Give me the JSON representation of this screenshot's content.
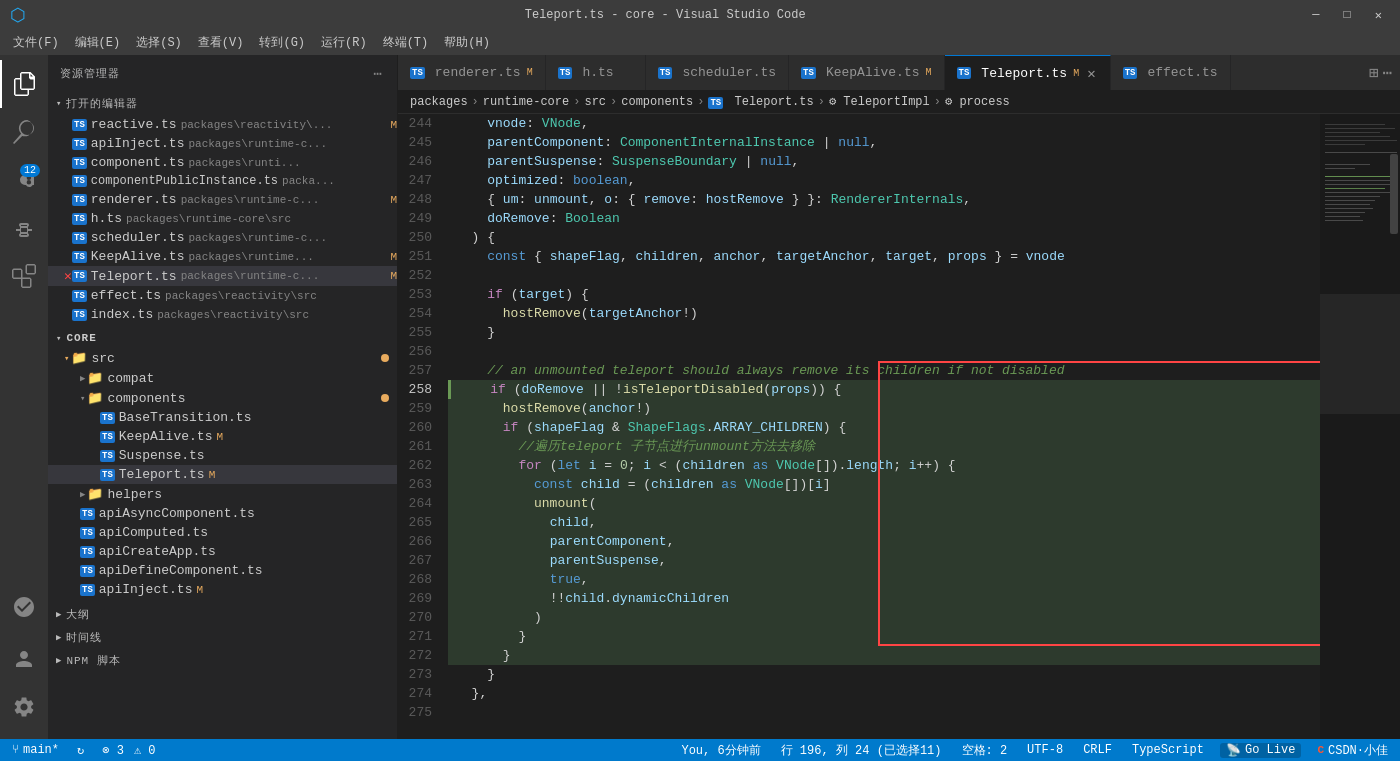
{
  "titleBar": {
    "title": "Teleport.ts - core - Visual Studio Code",
    "windowControls": [
      "minimize",
      "maximize",
      "close"
    ]
  },
  "menuBar": {
    "items": [
      "文件(F)",
      "编辑(E)",
      "选择(S)",
      "查看(V)",
      "转到(G)",
      "运行(R)",
      "终端(T)",
      "帮助(H)"
    ]
  },
  "activityBar": {
    "icons": [
      {
        "name": "explorer-icon",
        "symbol": "⎘",
        "active": true
      },
      {
        "name": "search-icon",
        "symbol": "🔍",
        "active": false
      },
      {
        "name": "source-control-icon",
        "symbol": "⑂",
        "active": false,
        "badge": "12"
      },
      {
        "name": "run-debug-icon",
        "symbol": "▷",
        "active": false
      },
      {
        "name": "extensions-icon",
        "symbol": "⊞",
        "active": false
      },
      {
        "name": "remote-icon",
        "symbol": "⊙",
        "active": false
      }
    ],
    "bottomIcons": [
      {
        "name": "account-icon",
        "symbol": "👤"
      },
      {
        "name": "settings-icon",
        "symbol": "⚙"
      }
    ]
  },
  "sidebar": {
    "title": "资源管理器",
    "openEditors": {
      "label": "打开的编辑器",
      "files": [
        {
          "name": "reactive.ts",
          "path": "packages\\reactivity\\...",
          "modified": true,
          "ts": true
        },
        {
          "name": "apiInject.ts",
          "path": "packages\\runtime-c...",
          "modified": false,
          "ts": true
        },
        {
          "name": "component.ts",
          "path": "packages\\runti...",
          "modified": false,
          "ts": true
        },
        {
          "name": "componentPublicInstance.ts",
          "path": "packa...",
          "modified": false,
          "ts": true
        },
        {
          "name": "renderer.ts",
          "path": "packages\\runtime-c...",
          "modified": true,
          "ts": true
        },
        {
          "name": "h.ts",
          "path": "packages\\runtime-core\\src",
          "modified": false,
          "ts": true
        },
        {
          "name": "scheduler.ts",
          "path": "packages\\runtime-c...",
          "modified": false,
          "ts": true
        },
        {
          "name": "KeepAlive.ts",
          "path": "packages\\runtime...",
          "modified": true,
          "ts": true
        },
        {
          "name": "Teleport.ts",
          "path": "packages\\runtime-c...",
          "modified": true,
          "active": true,
          "ts": true
        },
        {
          "name": "effect.ts",
          "path": "packages\\reactivity\\src",
          "modified": false,
          "ts": true
        },
        {
          "name": "index.ts",
          "path": "packages\\reactivity\\src",
          "modified": false,
          "ts": true
        }
      ]
    },
    "core": {
      "label": "CORE",
      "src": {
        "label": "src",
        "hasChanges": true,
        "children": [
          {
            "label": "compat",
            "type": "folder",
            "collapsed": true
          },
          {
            "label": "components",
            "type": "folder",
            "collapsed": false,
            "hasChanges": true,
            "children": [
              {
                "label": "BaseTransition.ts",
                "ts": true
              },
              {
                "label": "KeepAlive.ts",
                "ts": true,
                "modified": true
              },
              {
                "label": "Suspense.ts",
                "ts": true
              },
              {
                "label": "Teleport.ts",
                "ts": true,
                "active": true,
                "modified": true
              }
            ]
          },
          {
            "label": "helpers",
            "type": "folder",
            "collapsed": true
          },
          {
            "label": "apiAsyncComponent.ts",
            "ts": true
          },
          {
            "label": "apiComputed.ts",
            "ts": true
          },
          {
            "label": "apiCreateApp.ts",
            "ts": true
          },
          {
            "label": "apiDefineComponent.ts",
            "ts": true
          },
          {
            "label": "apiInject.ts",
            "ts": true,
            "modified": true
          }
        ]
      }
    },
    "otherSections": [
      {
        "label": "大纲"
      },
      {
        "label": "时间线"
      },
      {
        "label": "NPM 脚本"
      }
    ]
  },
  "tabs": [
    {
      "id": "renderer",
      "label": "renderer.ts",
      "modified": true,
      "active": false
    },
    {
      "id": "h",
      "label": "h.ts",
      "modified": false,
      "active": false
    },
    {
      "id": "scheduler",
      "label": "scheduler.ts",
      "modified": false,
      "active": false
    },
    {
      "id": "KeepAlive",
      "label": "KeepAlive.ts",
      "modified": true,
      "active": false
    },
    {
      "id": "Teleport",
      "label": "Teleport.ts",
      "modified": true,
      "active": true
    },
    {
      "id": "effect",
      "label": "effect.ts",
      "modified": false,
      "active": false
    }
  ],
  "breadcrumb": {
    "items": [
      "packages",
      "runtime-core",
      "src",
      "components",
      "Teleport.ts",
      "TeleportImpl",
      "process"
    ]
  },
  "codeLines": [
    {
      "num": 244,
      "text": "    vnode: VNode,"
    },
    {
      "num": 245,
      "text": "    parentComponent: ComponentInternalInstance | null,"
    },
    {
      "num": 246,
      "text": "    parentSuspense: SuspenseBoundary | null,"
    },
    {
      "num": 247,
      "text": "    optimized: boolean,"
    },
    {
      "num": 248,
      "text": "    { um: unmount, o: { remove: hostRemove } }: RendererInternals,"
    },
    {
      "num": 249,
      "text": "    doRemove: Boolean"
    },
    {
      "num": 250,
      "text": "  ) {"
    },
    {
      "num": 251,
      "text": "    const { shapeFlag, children, anchor, targetAnchor, target, props } = vnode"
    },
    {
      "num": 252,
      "text": ""
    },
    {
      "num": 253,
      "text": "    if (target) {"
    },
    {
      "num": 254,
      "text": "      hostRemove(targetAnchor!)"
    },
    {
      "num": 255,
      "text": "    }"
    },
    {
      "num": 256,
      "text": ""
    },
    {
      "num": 257,
      "text": "    // an unmounted teleport should always remove its children if not disabled"
    },
    {
      "num": 258,
      "text": "    if (doRemove || !isTeleportDisabled(props)) {",
      "highlighted": true
    },
    {
      "num": 259,
      "text": "      hostRemove(anchor!)",
      "highlighted": true
    },
    {
      "num": 260,
      "text": "      if (shapeFlag & ShapeFlags.ARRAY_CHILDREN) {",
      "highlighted": true
    },
    {
      "num": 261,
      "text": "        //遍历teleport 子节点进行unmount方法去移除",
      "highlighted": true
    },
    {
      "num": 262,
      "text": "        for (let i = 0; i < (children as VNode[]).length; i++) {",
      "highlighted": true
    },
    {
      "num": 263,
      "text": "          const child = (children as VNode[])[i]",
      "highlighted": true
    },
    {
      "num": 264,
      "text": "          unmount(",
      "highlighted": true
    },
    {
      "num": 265,
      "text": "            child,",
      "highlighted": true
    },
    {
      "num": 266,
      "text": "            parentComponent,",
      "highlighted": true
    },
    {
      "num": 267,
      "text": "            parentSuspense,",
      "highlighted": true
    },
    {
      "num": 268,
      "text": "            true,",
      "highlighted": true
    },
    {
      "num": 269,
      "text": "            !!child.dynamicChildren",
      "highlighted": true
    },
    {
      "num": 270,
      "text": "          )",
      "highlighted": true
    },
    {
      "num": 271,
      "text": "        }",
      "highlighted": true
    },
    {
      "num": 272,
      "text": "      }",
      "highlighted": true
    },
    {
      "num": 273,
      "text": "    }"
    },
    {
      "num": 274,
      "text": "  },"
    },
    {
      "num": 275,
      "text": ""
    }
  ],
  "statusBar": {
    "branch": "main*",
    "sync": "↻",
    "errors": "⊗ 3",
    "warnings": "⚠ 0",
    "user": "You, 6分钟前",
    "position": "行 196, 列 24 (已选择11)",
    "spaces": "空格: 2",
    "encoding": "UTF-8",
    "lineEnding": "CRLF",
    "language": "TypeScript",
    "goLive": "Go Live",
    "csdn": "CSDN·小佳"
  }
}
